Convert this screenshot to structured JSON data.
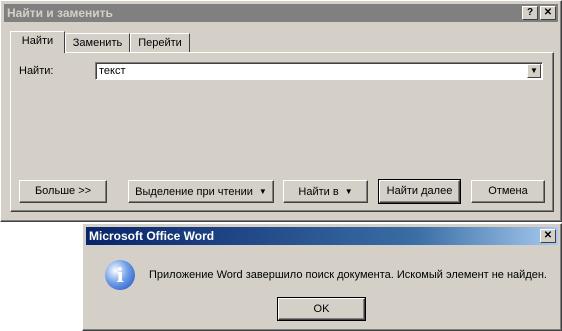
{
  "find_dialog": {
    "title": "Найти и заменить",
    "help_label": "?",
    "close_label": "✕",
    "tabs": [
      {
        "label": "Найти"
      },
      {
        "label": "Заменить"
      },
      {
        "label": "Перейти"
      }
    ],
    "find_label": "Найти:",
    "find_value": "текст",
    "more_button": "Больше >>",
    "reading_highlight_button": "Выделение при чтении",
    "find_in_button": "Найти в",
    "find_next_button": "Найти далее",
    "cancel_button": "Отмена"
  },
  "message_box": {
    "title": "Microsoft Office Word",
    "close_label": "✕",
    "icon": "info-icon",
    "message": "Приложение Word завершило поиск документа. Искомый элемент не найден.",
    "ok_button": "OK"
  }
}
